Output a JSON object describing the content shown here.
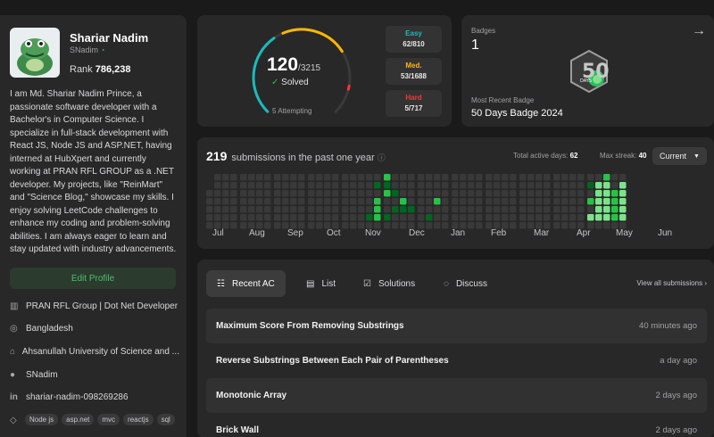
{
  "profile": {
    "name": "Shariar Nadim",
    "username": "SNadim",
    "rank_label": "Rank",
    "rank_value": "786,238",
    "bio": "I am Md. Shariar Nadim Prince, a passionate software developer with a Bachelor's in Computer Science. I specialize in full-stack development with React JS, Node JS and ASP.NET, having interned at HubXpert and currently working at PRAN RFL GROUP as a .NET developer. My projects, like \"ReinMart\" and \"Science Blog,\" showcase my skills. I enjoy solving LeetCode challenges to enhance my coding and problem-solving abilities. I am always eager to learn and stay updated with industry advancements.",
    "edit_label": "Edit Profile",
    "work": "PRAN RFL Group | Dot Net Developer",
    "location": "Bangladesh",
    "school": "Ahsanullah University of Science and ...",
    "github": "SNadim",
    "linkedin": "shariar-nadim-098269286",
    "skills": [
      "Node js",
      "asp.net",
      "mvc",
      "reactjs",
      "sql"
    ]
  },
  "solved": {
    "count": "120",
    "total": "/3215",
    "label": "Solved",
    "attempting": "5 Attempting",
    "easy_label": "Easy",
    "easy_count": "62/810",
    "medium_label": "Med.",
    "medium_count": "53/1688",
    "hard_label": "Hard",
    "hard_count": "5/717",
    "colors": {
      "easy": "#1cbaba",
      "medium": "#ffb700",
      "hard": "#f63737"
    },
    "progress": {
      "easy": 0.0765,
      "medium": 0.0314,
      "hard": 0.007
    }
  },
  "badges": {
    "title": "Badges",
    "count": "1",
    "recent_label": "Most Recent Badge",
    "recent_name": "50 Days Badge 2024",
    "badge_text": "DAYS",
    "badge_number": "50"
  },
  "heatmap": {
    "submissions": "219",
    "subtitle": "submissions in the past one year",
    "active_label": "Total active days:",
    "active_value": "62",
    "streak_label": "Max streak:",
    "streak_value": "40",
    "period": "Current",
    "months": [
      "Jul",
      "Aug",
      "Sep",
      "Oct",
      "Nov",
      "Dec",
      "Jan",
      "Feb",
      "Mar",
      "Apr",
      "May",
      "Jun"
    ],
    "colors": {
      "empty": "#393939",
      "l1": "#016620",
      "l2": "#28c244",
      "l3": "#7fe18b"
    }
  },
  "recent": {
    "tabs": [
      "Recent AC",
      "List",
      "Solutions",
      "Discuss"
    ],
    "view_all": "View all submissions",
    "items": [
      {
        "title": "Maximum Score From Removing Substrings",
        "time": "40 minutes ago"
      },
      {
        "title": "Reverse Substrings Between Each Pair of Parentheses",
        "time": "a day ago"
      },
      {
        "title": "Monotonic Array",
        "time": "2 days ago"
      },
      {
        "title": "Brick Wall",
        "time": "2 days ago"
      }
    ]
  }
}
